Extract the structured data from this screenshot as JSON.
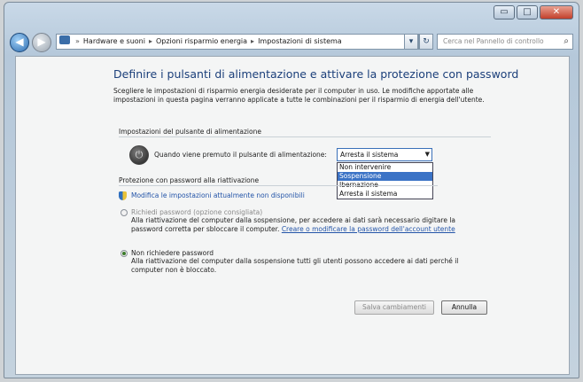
{
  "window": {
    "minimize_glyph": "▭",
    "maximize_glyph": "□",
    "close_glyph": "✕"
  },
  "nav": {
    "back_glyph": "◀",
    "forward_glyph": "▶",
    "breadcrumb": [
      "Hardware e suoni",
      "Opzioni risparmio energia",
      "Impostazioni di sistema"
    ],
    "search_placeholder": "Cerca nel Pannello di controllo",
    "refresh_glyph": "↻",
    "history_glyph": "▾"
  },
  "page": {
    "title": "Definire i pulsanti di alimentazione e attivare la protezione con password",
    "description": "Scegliere le impostazioni di risparmio energia desiderate per il computer in uso. Le modifiche apportate alle impostazioni in questa pagina verranno applicate a tutte le combinazioni per il risparmio di energia dell'utente.",
    "power_section_label": "Impostazioni del pulsante di alimentazione",
    "power_question": "Quando viene premuto il pulsante di alimentazione:",
    "power_selected": "Arresta il sistema",
    "power_options": [
      "Non intervenire",
      "Sospensione",
      "Ibernazione",
      "Arresta il sistema"
    ],
    "highlighted_option_index": 1,
    "password_section_label": "Protezione con password alla riattivazione",
    "change_settings_link": "Modifica le impostazioni attualmente non disponibili",
    "require_password_label": "Richiedi password (opzione consigliata)",
    "require_password_desc": "Alla riattivazione del computer dalla sospensione, per accedere ai dati sarà necessario digitare la password corretta per sbloccare il computer.",
    "require_password_link": "Creare o modificare la password dell'account utente",
    "no_password_label": "Non richiedere password",
    "no_password_desc": "Alla riattivazione del computer dalla sospensione tutti gli utenti possono accedere ai dati perché il computer non è bloccato.",
    "save_button": "Salva cambiamenti",
    "cancel_button": "Annulla"
  }
}
